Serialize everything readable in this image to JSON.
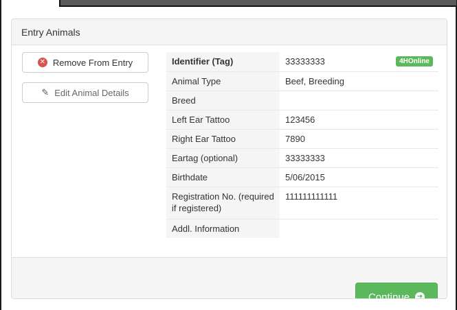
{
  "panel": {
    "title": "Entry Animals"
  },
  "actions": {
    "remove_label": "Remove From Entry",
    "edit_label": "Edit Animal Details"
  },
  "details": {
    "rows": [
      {
        "label": "Identifier (Tag)",
        "value": "33333333",
        "badge": "4HOnline"
      },
      {
        "label": "Animal Type",
        "value": "Beef, Breeding"
      },
      {
        "label": "Breed",
        "value": ""
      },
      {
        "label": "Left Ear Tattoo",
        "value": "123456"
      },
      {
        "label": "Right Ear Tattoo",
        "value": "7890"
      },
      {
        "label": "Eartag (optional)",
        "value": "33333333"
      },
      {
        "label": "Birthdate",
        "value": "5/06/2015"
      },
      {
        "label": "Registration No. (required if registered)",
        "value": "111111111111"
      },
      {
        "label": "Addl. Information",
        "value": ""
      }
    ]
  },
  "footer": {
    "continue_label": "Continue"
  },
  "icons": {
    "remove": "times-circle-icon",
    "edit": "pencil-icon",
    "continue": "arrow-circle-right-icon"
  },
  "colors": {
    "success": "#5cb85c",
    "danger": "#d9534f",
    "panel_bg": "#f5f5f5"
  }
}
